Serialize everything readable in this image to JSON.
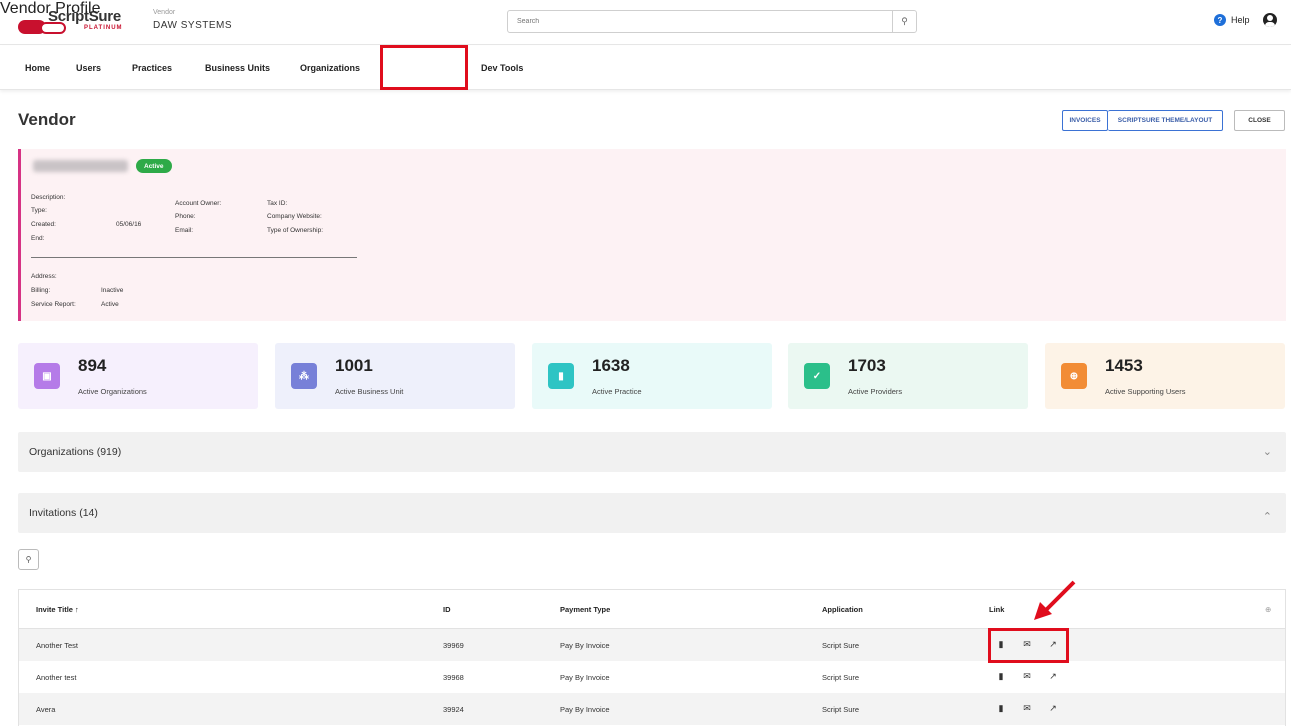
{
  "header": {
    "logo_text": "ScriptSure",
    "logo_sub": "PLATINUM",
    "vendor_label": "Vendor",
    "vendor_name": "DAW SYSTEMS",
    "search_placeholder": "Search",
    "help_label": "Help"
  },
  "nav": {
    "items": [
      "Home",
      "Users",
      "Practices",
      "Business Units",
      "Organizations",
      "Vendor Profile",
      "Dev Tools"
    ],
    "active": "Vendor Profile"
  },
  "page": {
    "title": "Vendor",
    "buttons": [
      "INVOICES",
      "SCRIPTSURE THEME/LAYOUT",
      "CLOSE"
    ]
  },
  "profile": {
    "status": "Active",
    "fields_col1": [
      {
        "label": "Description:",
        "value": ""
      },
      {
        "label": "Type:",
        "value": ""
      },
      {
        "label": "Created:",
        "value": "05/06/16"
      },
      {
        "label": "End:",
        "value": ""
      }
    ],
    "fields_col2": [
      {
        "label": "Account Owner:",
        "value": ""
      },
      {
        "label": "Phone:",
        "value": ""
      },
      {
        "label": "Email:",
        "value": ""
      }
    ],
    "fields_col3": [
      {
        "label": "Tax ID:",
        "value": ""
      },
      {
        "label": "Company Website:",
        "value": ""
      },
      {
        "label": "Type of Ownership:",
        "value": ""
      }
    ],
    "fields_bottom": [
      {
        "label": "Address:",
        "value": ""
      },
      {
        "label": "Billing:",
        "value": "Inactive"
      },
      {
        "label": "Service Report:",
        "value": "Active"
      }
    ]
  },
  "stats": [
    {
      "value": "894",
      "label": "Active Organizations",
      "bg": "#f6f0fd",
      "icon_bg": "#b57be8",
      "icon": "briefcase-icon",
      "glyph": "▣"
    },
    {
      "value": "1001",
      "label": "Active Business Unit",
      "bg": "#eef0fb",
      "icon_bg": "#7780d8",
      "icon": "hierarchy-icon",
      "glyph": "⁂"
    },
    {
      "value": "1638",
      "label": "Active Practice",
      "bg": "#e9faf9",
      "icon_bg": "#2ec4c4",
      "icon": "bookmark-icon",
      "glyph": "▮"
    },
    {
      "value": "1703",
      "label": "Active Providers",
      "bg": "#ebf8f2",
      "icon_bg": "#2bbf8a",
      "icon": "check-circle-icon",
      "glyph": "✓"
    },
    {
      "value": "1453",
      "label": "Active Supporting Users",
      "bg": "#fdf3e7",
      "icon_bg": "#f28c35",
      "icon": "lifebuoy-icon",
      "glyph": "⊕"
    }
  ],
  "sections": {
    "organizations": "Organizations (919)",
    "invitations": "Invitations (14)"
  },
  "table": {
    "headers": [
      "Invite Title ↑",
      "ID",
      "Payment Type",
      "Application",
      "Link"
    ],
    "rows": [
      {
        "title": "Another Test",
        "id": "39969",
        "payment": "Pay By Invoice",
        "app": "Script Sure"
      },
      {
        "title": "Another test",
        "id": "39968",
        "payment": "Pay By Invoice",
        "app": "Script Sure"
      },
      {
        "title": "Avera",
        "id": "39924",
        "payment": "Pay By Invoice",
        "app": "Script Sure"
      }
    ]
  },
  "colors": {
    "highlight": "#e00d1d",
    "active_badge": "#2eaa48",
    "accent": "#3b72d4"
  }
}
